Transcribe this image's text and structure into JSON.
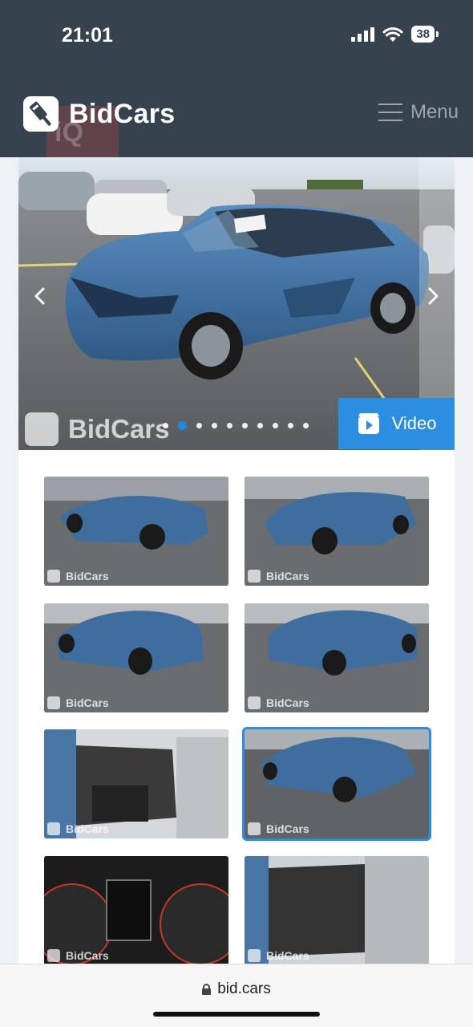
{
  "status_bar": {
    "time": "21:01",
    "battery": "38"
  },
  "header": {
    "logo_text": "BidCars",
    "menu_label": "Menu"
  },
  "gallery": {
    "watermark": "BidCars",
    "slide_count": 10,
    "active_slide": 1,
    "video_label": "Video",
    "thumb_watermark": "BidCars"
  },
  "browser": {
    "url": "bid.cars"
  },
  "colors": {
    "header_bg": "#36434f",
    "accent": "#2b8ee0",
    "car_blue": "#3f6e9e"
  }
}
